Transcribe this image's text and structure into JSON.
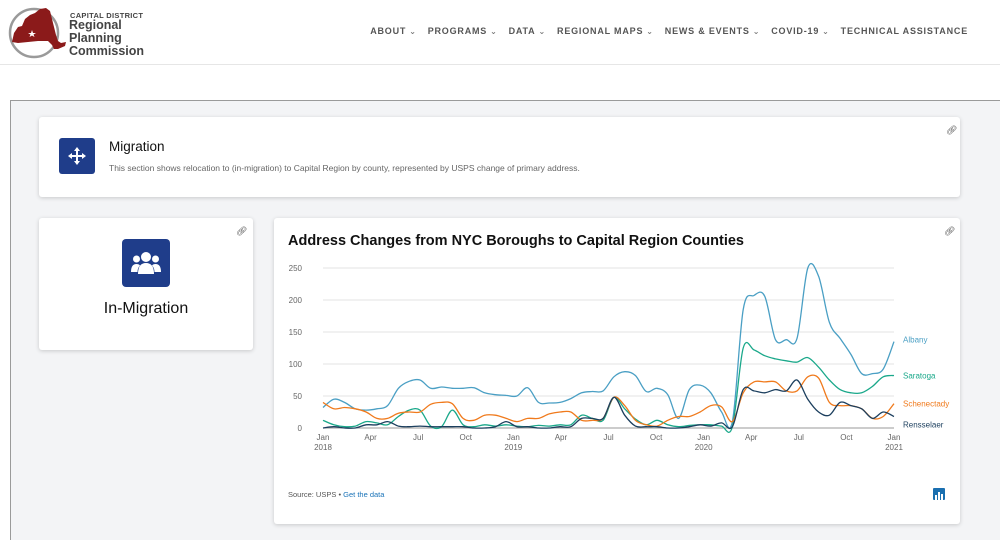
{
  "header": {
    "logo_small": "CAPITAL DISTRICT",
    "logo_line1": "Regional",
    "logo_line2": "Planning",
    "logo_line3": "Commission",
    "nav": [
      {
        "label": "ABOUT",
        "dropdown": true
      },
      {
        "label": "PROGRAMS",
        "dropdown": true
      },
      {
        "label": "DATA",
        "dropdown": true
      },
      {
        "label": "REGIONAL MAPS",
        "dropdown": true
      },
      {
        "label": "NEWS & EVENTS",
        "dropdown": true
      },
      {
        "label": "COVID-19",
        "dropdown": true
      },
      {
        "label": "TECHNICAL ASSISTANCE",
        "dropdown": false
      }
    ]
  },
  "migration": {
    "title": "Migration",
    "description": "This section shows relocation to (in-migration) to Capital Region by county, represented by USPS change of primary address."
  },
  "in_migration": {
    "label": "In-Migration"
  },
  "source": {
    "prefix": "Source: USPS • ",
    "link": "Get the data"
  },
  "colors": {
    "brand_blue": "#1f3d8a",
    "albany": "#4a9fc4",
    "saratoga": "#1aa88a",
    "schenectady": "#f07a1c",
    "rensselaer": "#1c3f5e"
  },
  "chart_data": {
    "type": "line",
    "title": "Address Changes from NYC Boroughs to Capital Region Counties",
    "ylim": [
      0,
      250
    ],
    "y_ticks": [
      0,
      50,
      100,
      150,
      200,
      250
    ],
    "x_tick_labels": [
      {
        "month": 0,
        "l1": "Jan",
        "l2": "2018"
      },
      {
        "month": 3,
        "l1": "Apr",
        "l2": ""
      },
      {
        "month": 6,
        "l1": "Jul",
        "l2": ""
      },
      {
        "month": 9,
        "l1": "Oct",
        "l2": ""
      },
      {
        "month": 12,
        "l1": "Jan",
        "l2": "2019"
      },
      {
        "month": 15,
        "l1": "Apr",
        "l2": ""
      },
      {
        "month": 18,
        "l1": "Jul",
        "l2": ""
      },
      {
        "month": 21,
        "l1": "Oct",
        "l2": ""
      },
      {
        "month": 24,
        "l1": "Jan",
        "l2": "2020"
      },
      {
        "month": 27,
        "l1": "Apr",
        "l2": ""
      },
      {
        "month": 30,
        "l1": "Jul",
        "l2": ""
      },
      {
        "month": 33,
        "l1": "Oct",
        "l2": ""
      },
      {
        "month": 36,
        "l1": "Jan",
        "l2": "2021"
      }
    ],
    "x_range": [
      "Jan 2018",
      "Jan 2021"
    ],
    "x_unit": "half-month steps from Jan 2018",
    "series": [
      {
        "name": "Albany",
        "color": "#4a9fc4",
        "values": [
          32,
          45,
          40,
          30,
          28,
          30,
          35,
          62,
          73,
          75,
          62,
          64,
          62,
          62,
          63,
          55,
          52,
          51,
          50,
          63,
          40,
          39,
          40,
          46,
          55,
          57,
          58,
          80,
          88,
          82,
          57,
          62,
          52,
          15,
          60,
          67,
          55,
          25,
          10,
          185,
          207,
          206,
          138,
          138,
          140,
          250,
          237,
          165,
          140,
          115,
          85,
          85,
          92,
          135
        ]
      },
      {
        "name": "Saratoga",
        "color": "#1aa88a",
        "values": [
          12,
          5,
          2,
          3,
          10,
          8,
          5,
          18,
          28,
          28,
          3,
          2,
          28,
          5,
          2,
          5,
          3,
          5,
          3,
          2,
          4,
          3,
          5,
          5,
          20,
          15,
          12,
          48,
          30,
          14,
          5,
          12,
          5,
          2,
          4,
          5,
          5,
          3,
          2,
          125,
          122,
          113,
          108,
          105,
          103,
          110,
          95,
          75,
          60,
          55,
          55,
          65,
          80,
          82
        ]
      },
      {
        "name": "Schenectady",
        "color": "#f07a1c",
        "values": [
          40,
          30,
          32,
          30,
          25,
          15,
          15,
          23,
          25,
          25,
          37,
          40,
          38,
          15,
          12,
          20,
          20,
          15,
          10,
          15,
          15,
          22,
          25,
          25,
          12,
          12,
          15,
          48,
          35,
          12,
          5,
          3,
          12,
          18,
          18,
          25,
          35,
          33,
          10,
          55,
          72,
          72,
          72,
          58,
          58,
          80,
          78,
          40,
          35,
          35,
          30,
          15,
          18,
          38
        ]
      },
      {
        "name": "Rensselaer",
        "color": "#1c3f5e",
        "values": [
          0,
          2,
          0,
          0,
          5,
          5,
          10,
          3,
          2,
          3,
          2,
          2,
          2,
          2,
          0,
          0,
          2,
          10,
          2,
          2,
          0,
          0,
          2,
          2,
          15,
          15,
          15,
          48,
          20,
          3,
          2,
          2,
          0,
          0,
          2,
          5,
          3,
          8,
          2,
          60,
          58,
          55,
          60,
          58,
          75,
          45,
          25,
          20,
          40,
          35,
          30,
          15,
          25,
          18
        ]
      }
    ],
    "legend_placement": "line-end labels"
  }
}
